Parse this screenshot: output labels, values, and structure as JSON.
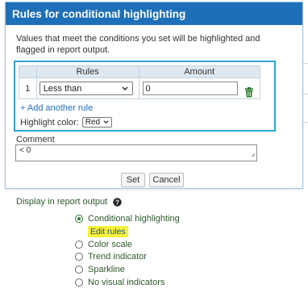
{
  "dialog": {
    "title": "Rules for conditional highlighting",
    "intro": "Values that meet the conditions you set will be highlighted and flagged in report output."
  },
  "rules": {
    "headers": {
      "rules": "Rules",
      "amount": "Amount"
    },
    "rows": [
      {
        "index": "1",
        "condition": "Less than",
        "amount": "0"
      }
    ],
    "add_rule_label": "+ Add another rule",
    "highlight_label": "Highlight color:",
    "highlight_value": "Red"
  },
  "comment": {
    "label": "Comment",
    "value": "< 0"
  },
  "buttons": {
    "set": "Set",
    "cancel": "Cancel"
  },
  "display": {
    "label": "Display in report output",
    "options": [
      {
        "label": "Conditional highlighting",
        "checked": true
      },
      {
        "label": "Color scale",
        "checked": false
      },
      {
        "label": "Trend indicator",
        "checked": false
      },
      {
        "label": "Sparkline",
        "checked": false
      },
      {
        "label": "No visual indicators",
        "checked": false
      }
    ],
    "edit_rules_label": "Edit rules"
  },
  "colors": {
    "title_bar": "#1d6fb8",
    "focus_border": "#2aa8d8",
    "link": "#1f6fc4",
    "radio_selected": "#2e7d32",
    "edit_highlight": "#f5f23a"
  },
  "icons": {
    "delete": "trash-icon",
    "help": "help-icon",
    "dropdown": "chevron-down-icon"
  }
}
